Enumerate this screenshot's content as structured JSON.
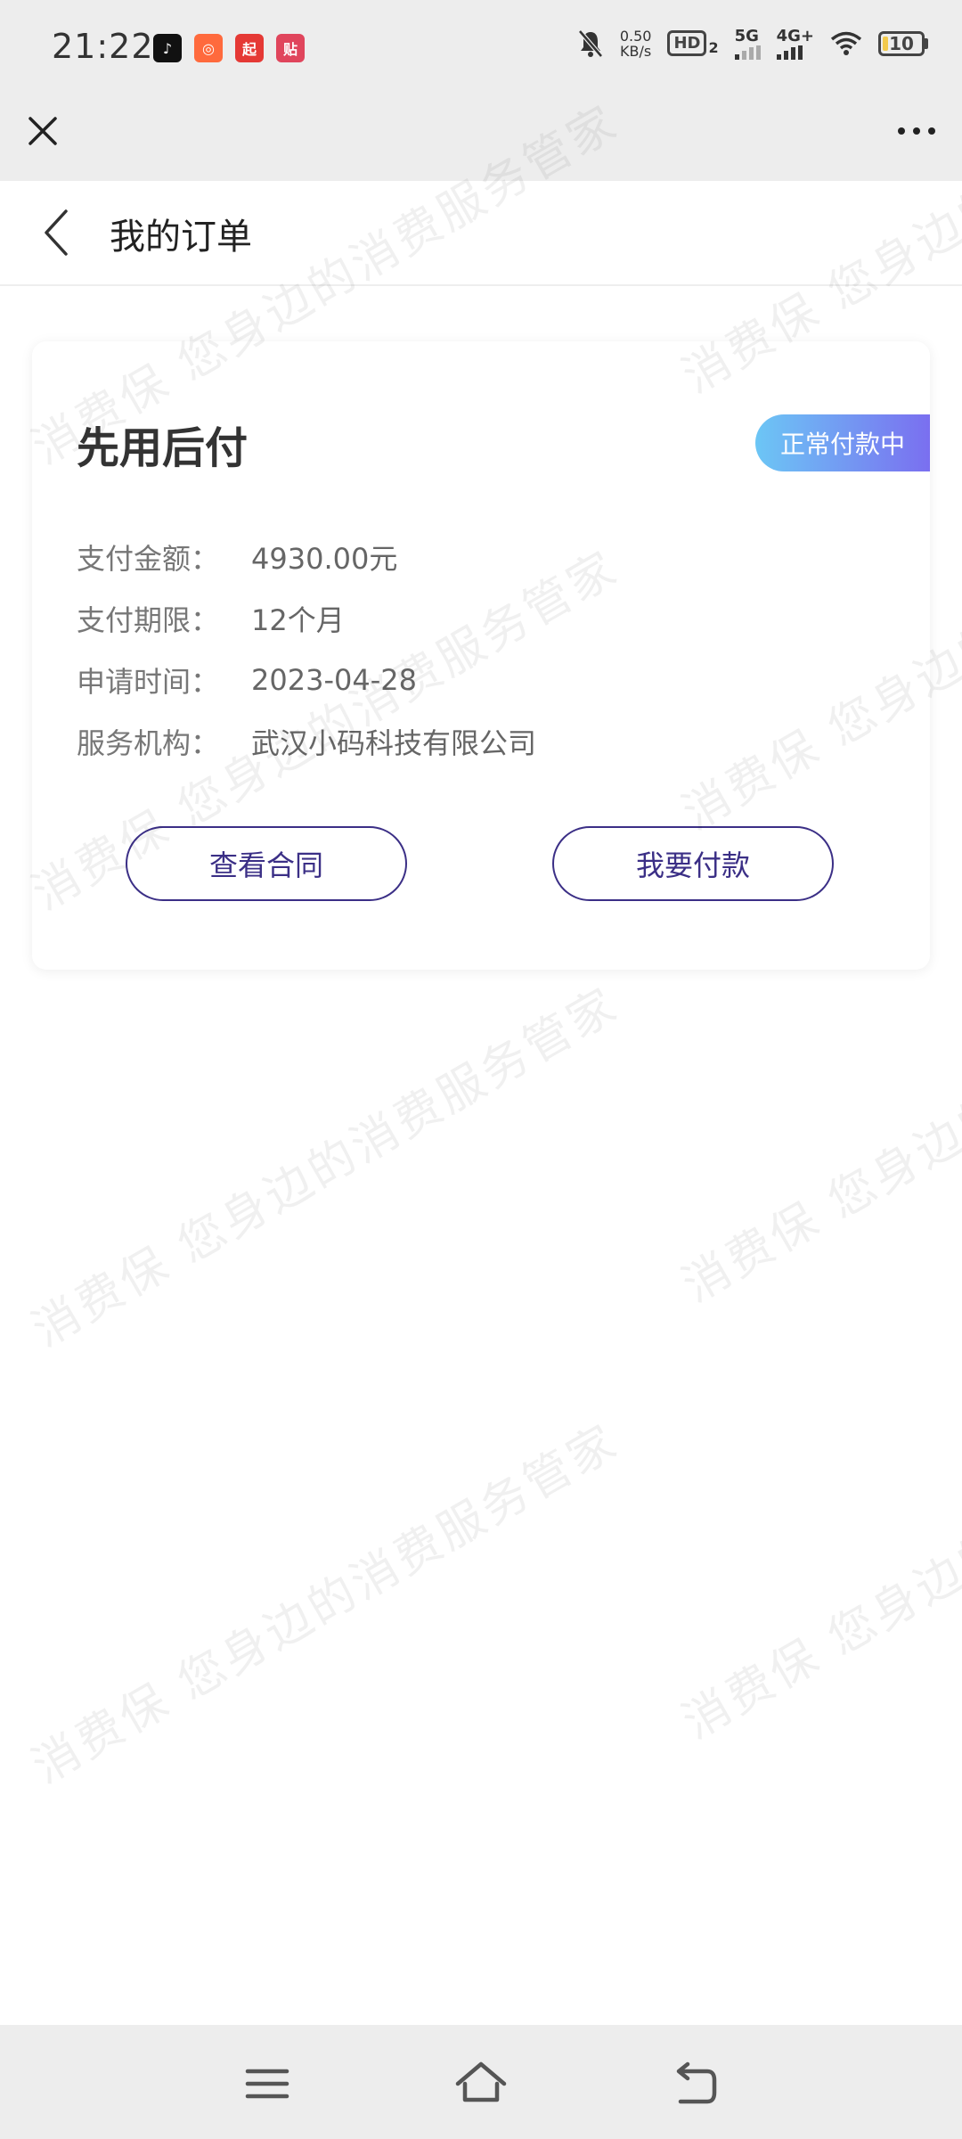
{
  "status_bar": {
    "time": "21:22",
    "net_speed_value": "0.50",
    "net_speed_unit": "KB/s",
    "hd_label": "HD",
    "hd_sub": "2",
    "net_5g": "5G",
    "net_4g": "4G+",
    "battery": "10",
    "app_icons": [
      "tiktok-icon",
      "kuaishou-icon",
      "qidian-icon",
      "tieba-icon"
    ]
  },
  "browser_bar": {
    "close_icon": "close-icon",
    "more_icon": "more-icon"
  },
  "header": {
    "title": "我的订单",
    "back_icon": "chevron-left-icon"
  },
  "order": {
    "title": "先用后付",
    "status": "正常付款中",
    "status_gradient": [
      "#6cc6f5",
      "#7a6ff0"
    ],
    "rows": [
      {
        "label": "支付金额：",
        "value": "4930.00元"
      },
      {
        "label": "支付期限：",
        "value": "12个月"
      },
      {
        "label": "申请时间：",
        "value": "2023-04-28"
      },
      {
        "label": "服务机构：",
        "value": "武汉小码科技有限公司"
      }
    ],
    "buttons": {
      "contract": "查看合同",
      "pay": "我要付款"
    },
    "accent_color": "#3b2f86"
  },
  "watermark": {
    "line1": "消费保 您身边的消费服务管家"
  },
  "bottom_nav": {
    "menu_icon": "menu-icon",
    "home_icon": "home-icon",
    "back_icon": "back-icon"
  }
}
